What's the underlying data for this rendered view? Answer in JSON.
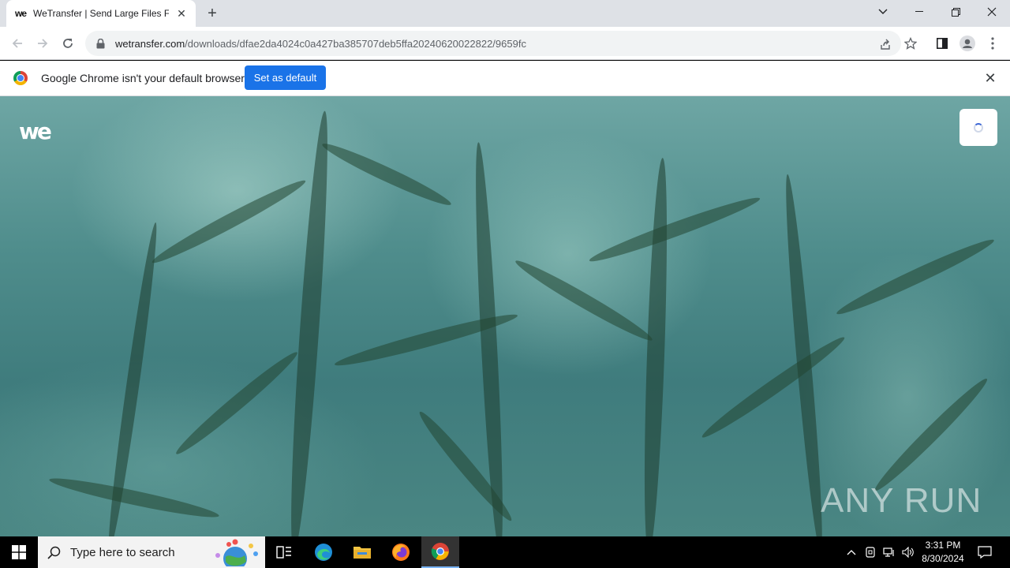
{
  "browser": {
    "tab": {
      "favicon_text": "we",
      "title": "WeTransfer | Send Large Files Fast"
    },
    "url": {
      "host": "wetransfer.com",
      "path": "/downloads/dfae2da4024c0a427ba385707deb5ffa20240620022822/9659fc"
    },
    "infobar": {
      "message": "Google Chrome isn't your default browser",
      "button_label": "Set as default"
    }
  },
  "page": {
    "logo_text": "we",
    "watermark": "ANY RUN"
  },
  "taskbar": {
    "search_placeholder": "Type here to search",
    "time": "3:31 PM",
    "date": "8/30/2024"
  },
  "colors": {
    "accent": "#1a73e8",
    "tabstrip": "#dee1e6"
  }
}
